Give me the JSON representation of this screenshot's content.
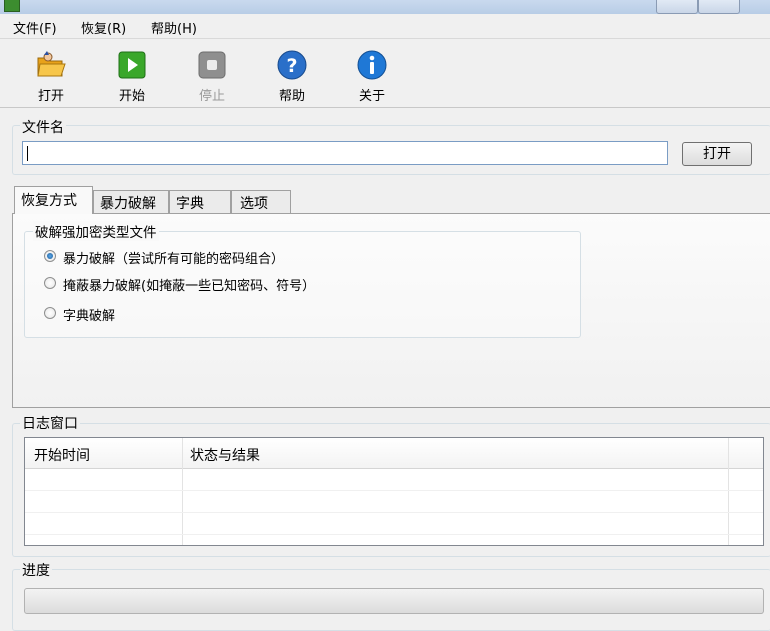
{
  "window": {
    "title": ""
  },
  "menu": {
    "items": [
      "文件(F)",
      "恢复(R)",
      "帮助(H)"
    ]
  },
  "toolbar": {
    "buttons": [
      {
        "label": "打开",
        "icon": "folder-open-icon",
        "enabled": true
      },
      {
        "label": "开始",
        "icon": "play-icon",
        "enabled": true
      },
      {
        "label": "停止",
        "icon": "stop-icon",
        "enabled": false
      },
      {
        "label": "帮助",
        "icon": "help-icon",
        "enabled": true
      },
      {
        "label": "关于",
        "icon": "info-icon",
        "enabled": true
      }
    ]
  },
  "file": {
    "group_title": "文件名",
    "value": "",
    "open_button": "打开"
  },
  "tabs": [
    "恢复方式",
    "暴力破解",
    "字典",
    "选项"
  ],
  "recovery": {
    "group_title": "破解强加密类型文件",
    "options": [
      {
        "label": "暴力破解（尝试所有可能的密码组合）",
        "checked": true
      },
      {
        "label": "掩蔽暴力破解(如掩蔽一些已知密码、符号）",
        "checked": false
      },
      {
        "label": "字典破解",
        "checked": false
      }
    ]
  },
  "log": {
    "group_title": "日志窗口",
    "columns": [
      "开始时间",
      "状态与结果"
    ],
    "rows": []
  },
  "progress": {
    "group_title": "进度",
    "percent": 0
  },
  "colors": {
    "play": "#3aa72a",
    "help": "#2a6fc9",
    "info": "#1f78d6",
    "stop": "#8f8f8f"
  }
}
